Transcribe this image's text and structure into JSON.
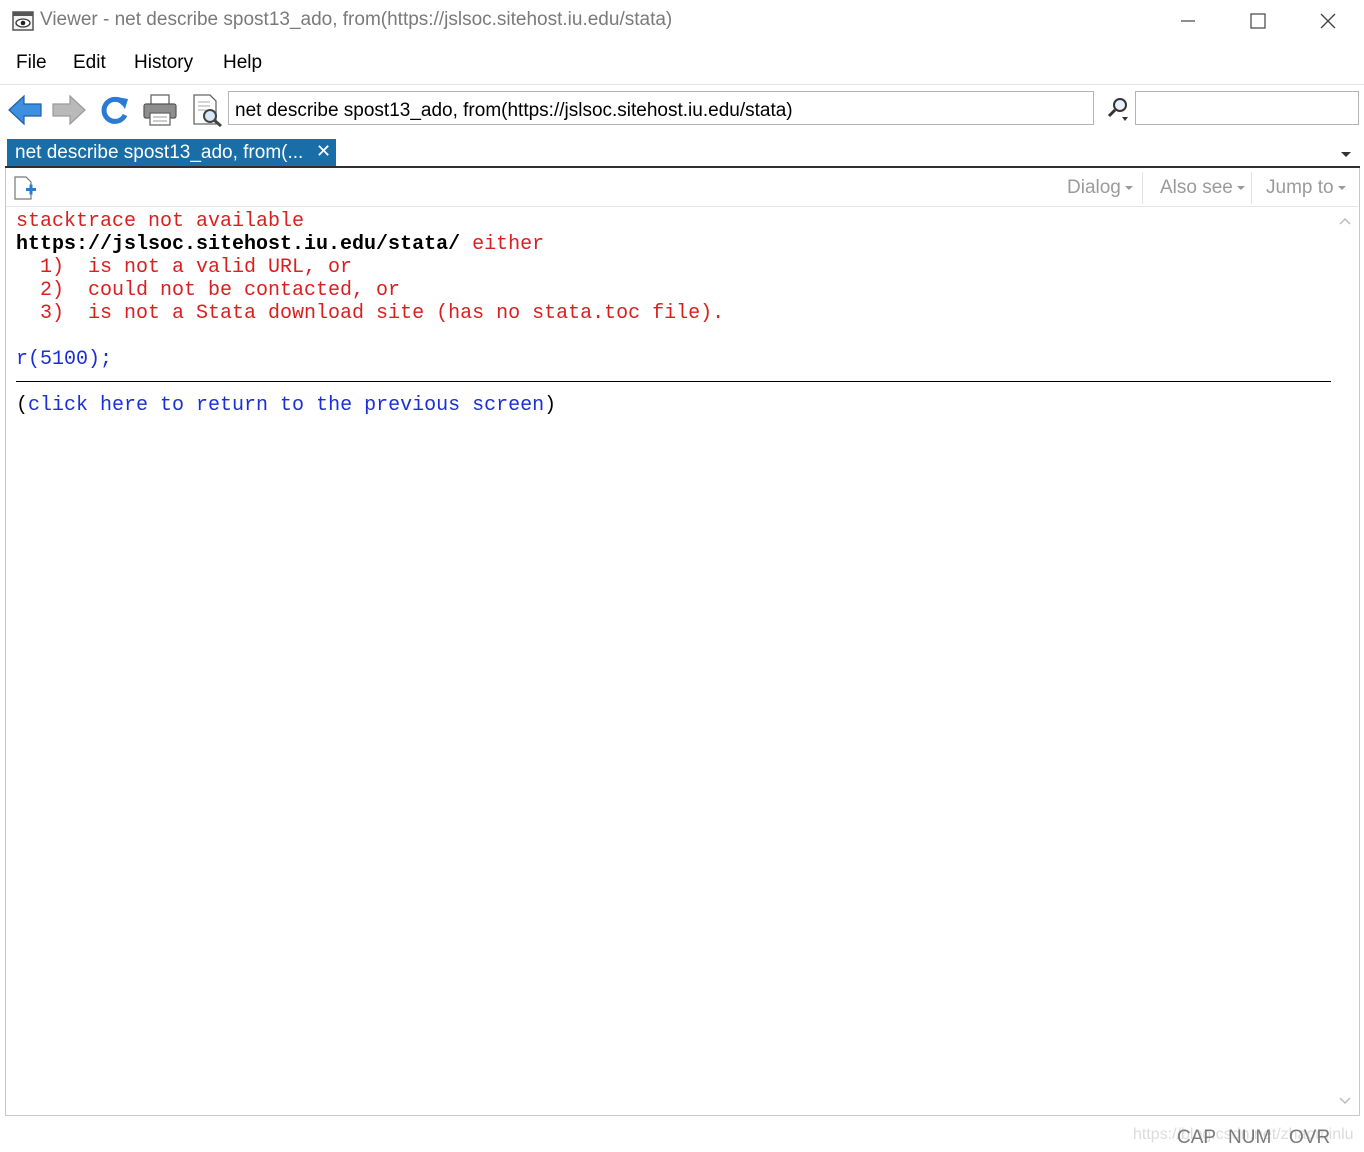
{
  "window": {
    "title": "Viewer - net describe spost13_ado, from(https://jslsoc.sitehost.iu.edu/stata)"
  },
  "menu": [
    "File",
    "Edit",
    "History",
    "Help"
  ],
  "toolbar": {
    "command": "net describe spost13_ado, from(https://jslsoc.sitehost.iu.edu/stata)",
    "search_value": ""
  },
  "tab": {
    "label": "net describe spost13_ado, from(...",
    "close": "✕"
  },
  "doc_toolbar": {
    "dialog": "Dialog",
    "also_see": "Also see",
    "jump_to": "Jump to"
  },
  "content": {
    "line1": "stacktrace not available",
    "line2_url": "https://jslsoc.sitehost.iu.edu/stata/",
    "line2_rest": " either",
    "line3": "  1)  is not a valid URL, or",
    "line4": "  2)  could not be contacted, or",
    "line5": "  3)  is not a Stata download site (has no stata.toc file).",
    "rc": "r(5100);",
    "return_open": "(",
    "return_link": "click here to return to the previous screen",
    "return_close": ")"
  },
  "status": {
    "cap": "CAP",
    "num": "NUM",
    "ovr": "OVR",
    "watermark": "https://blog.csdn.net/zhaominlu"
  },
  "colors": {
    "error_red": "#d92020",
    "link_blue": "#1a2fd6",
    "tab_blue": "#1a6ea8"
  }
}
